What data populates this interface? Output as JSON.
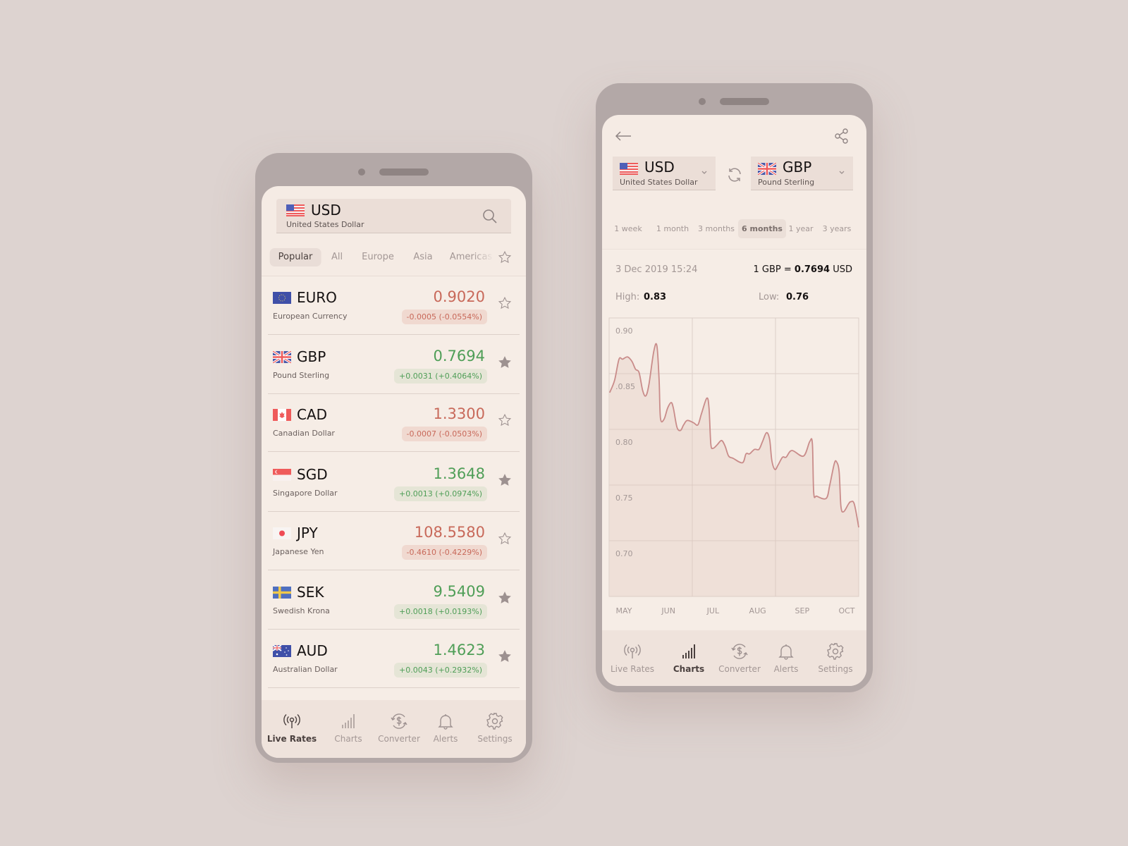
{
  "colors": {
    "background": "#ddd3d0",
    "frame": "#b3a8a7",
    "screen": "#f5ebe4",
    "positive": "#4f9e57",
    "negative": "#c8695a",
    "chart_line": "#c98c8a"
  },
  "live_rates": {
    "base": {
      "flag": "us-flag",
      "code": "USD",
      "name": "United States Dollar"
    },
    "search_icon": "search-icon",
    "tabs": [
      {
        "label": "Popular",
        "active": true
      },
      {
        "label": "All"
      },
      {
        "label": "Europe"
      },
      {
        "label": "Asia"
      },
      {
        "label": "Americas"
      }
    ],
    "favorites_icon": "star-outline-icon",
    "rows": [
      {
        "flag": "eu",
        "code": "EURO",
        "name": "European Currency",
        "value": "0.9020",
        "change": "-0.0005 (-0.0554%)",
        "trend": "down",
        "starred": false
      },
      {
        "flag": "gb",
        "code": "GBP",
        "name": "Pound Sterling",
        "value": "0.7694",
        "change": "+0.0031 (+0.4064%)",
        "trend": "up",
        "starred": true
      },
      {
        "flag": "ca",
        "code": "CAD",
        "name": "Canadian Dollar",
        "value": "1.3300",
        "change": "-0.0007 (-0.0503%)",
        "trend": "down",
        "starred": false
      },
      {
        "flag": "sg",
        "code": "SGD",
        "name": "Singapore Dollar",
        "value": "1.3648",
        "change": "+0.0013 (+0.0974%)",
        "trend": "up",
        "starred": true
      },
      {
        "flag": "jp",
        "code": "JPY",
        "name": "Japanese Yen",
        "value": "108.5580",
        "change": "-0.4610 (-0.4229%)",
        "trend": "down",
        "starred": false
      },
      {
        "flag": "se",
        "code": "SEK",
        "name": "Swedish Krona",
        "value": "9.5409",
        "change": "+0.0018 (+0.0193%)",
        "trend": "up",
        "starred": true
      },
      {
        "flag": "au",
        "code": "AUD",
        "name": "Australian Dollar",
        "value": "1.4623",
        "change": "+0.0043 (+0.2932%)",
        "trend": "up",
        "starred": true
      }
    ],
    "nav": [
      {
        "label": "Live Rates",
        "icon": "broadcast-icon",
        "active": true
      },
      {
        "label": "Charts",
        "icon": "signal-bars-icon"
      },
      {
        "label": "Converter",
        "icon": "currency-exchange-icon"
      },
      {
        "label": "Alerts",
        "icon": "bell-icon"
      },
      {
        "label": "Settings",
        "icon": "gear-icon"
      }
    ]
  },
  "charts": {
    "from": {
      "code": "USD",
      "name": "United States Dollar"
    },
    "to": {
      "code": "GBP",
      "name": "Pound Sterling"
    },
    "periods": [
      {
        "label": "1 week"
      },
      {
        "label": "1 month"
      },
      {
        "label": "3 months"
      },
      {
        "label": "6 months",
        "active": true
      },
      {
        "label": "1 year"
      },
      {
        "label": "3 years"
      }
    ],
    "timestamp": "3 Dec 2019 15:24",
    "rate": {
      "lhs": "1 GBP = ",
      "value": "0.7694",
      "unit": " USD"
    },
    "high_label": "High:",
    "high": "0.83",
    "low_label": "Low:",
    "low": "0.76",
    "nav": [
      {
        "label": "Live Rates",
        "icon": "broadcast-icon"
      },
      {
        "label": "Charts",
        "icon": "signal-bars-icon",
        "active": true
      },
      {
        "label": "Converter",
        "icon": "currency-exchange-icon"
      },
      {
        "label": "Alerts",
        "icon": "bell-icon"
      },
      {
        "label": "Settings",
        "icon": "gear-icon"
      }
    ]
  },
  "chart_data": {
    "type": "area",
    "x_ticks": [
      "MAY",
      "JUN",
      "JUL",
      "AUG",
      "SEP",
      "OCT"
    ],
    "y_ticks": [
      "0.90",
      ".0.85",
      "0.80",
      "0.75",
      "0.70"
    ],
    "ylim": [
      0.65,
      0.9
    ],
    "xlim_months_from_may": [
      -0.33,
      5.27
    ],
    "grid": true,
    "points": [
      [
        -0.32,
        0.833
      ],
      [
        -0.21,
        0.844
      ],
      [
        -0.11,
        0.863
      ],
      [
        -0.03,
        0.863
      ],
      [
        0.08,
        0.865
      ],
      [
        0.18,
        0.861
      ],
      [
        0.26,
        0.854
      ],
      [
        0.34,
        0.851
      ],
      [
        0.42,
        0.835
      ],
      [
        0.49,
        0.83
      ],
      [
        0.56,
        0.84
      ],
      [
        0.67,
        0.87
      ],
      [
        0.74,
        0.875
      ],
      [
        0.79,
        0.844
      ],
      [
        0.82,
        0.81
      ],
      [
        0.9,
        0.809
      ],
      [
        0.98,
        0.819
      ],
      [
        1.06,
        0.824
      ],
      [
        1.11,
        0.819
      ],
      [
        1.19,
        0.802
      ],
      [
        1.27,
        0.799
      ],
      [
        1.34,
        0.804
      ],
      [
        1.42,
        0.808
      ],
      [
        1.56,
        0.806
      ],
      [
        1.66,
        0.804
      ],
      [
        1.74,
        0.814
      ],
      [
        1.86,
        0.828
      ],
      [
        1.91,
        0.819
      ],
      [
        1.95,
        0.787
      ],
      [
        2.0,
        0.783
      ],
      [
        2.09,
        0.786
      ],
      [
        2.19,
        0.79
      ],
      [
        2.27,
        0.785
      ],
      [
        2.35,
        0.776
      ],
      [
        2.45,
        0.774
      ],
      [
        2.66,
        0.77
      ],
      [
        2.74,
        0.778
      ],
      [
        2.82,
        0.778
      ],
      [
        2.93,
        0.782
      ],
      [
        3.03,
        0.782
      ],
      [
        3.11,
        0.789
      ],
      [
        3.2,
        0.797
      ],
      [
        3.27,
        0.791
      ],
      [
        3.32,
        0.772
      ],
      [
        3.39,
        0.764
      ],
      [
        3.46,
        0.768
      ],
      [
        3.56,
        0.775
      ],
      [
        3.64,
        0.775
      ],
      [
        3.77,
        0.781
      ],
      [
        4.03,
        0.776
      ],
      [
        4.17,
        0.789
      ],
      [
        4.23,
        0.787
      ],
      [
        4.26,
        0.743
      ],
      [
        4.33,
        0.74
      ],
      [
        4.54,
        0.738
      ],
      [
        4.62,
        0.75
      ],
      [
        4.72,
        0.769
      ],
      [
        4.77,
        0.771
      ],
      [
        4.83,
        0.762
      ],
      [
        4.87,
        0.731
      ],
      [
        4.93,
        0.726
      ],
      [
        5.04,
        0.733
      ],
      [
        5.09,
        0.735
      ],
      [
        5.17,
        0.733
      ],
      [
        5.27,
        0.712
      ]
    ]
  }
}
